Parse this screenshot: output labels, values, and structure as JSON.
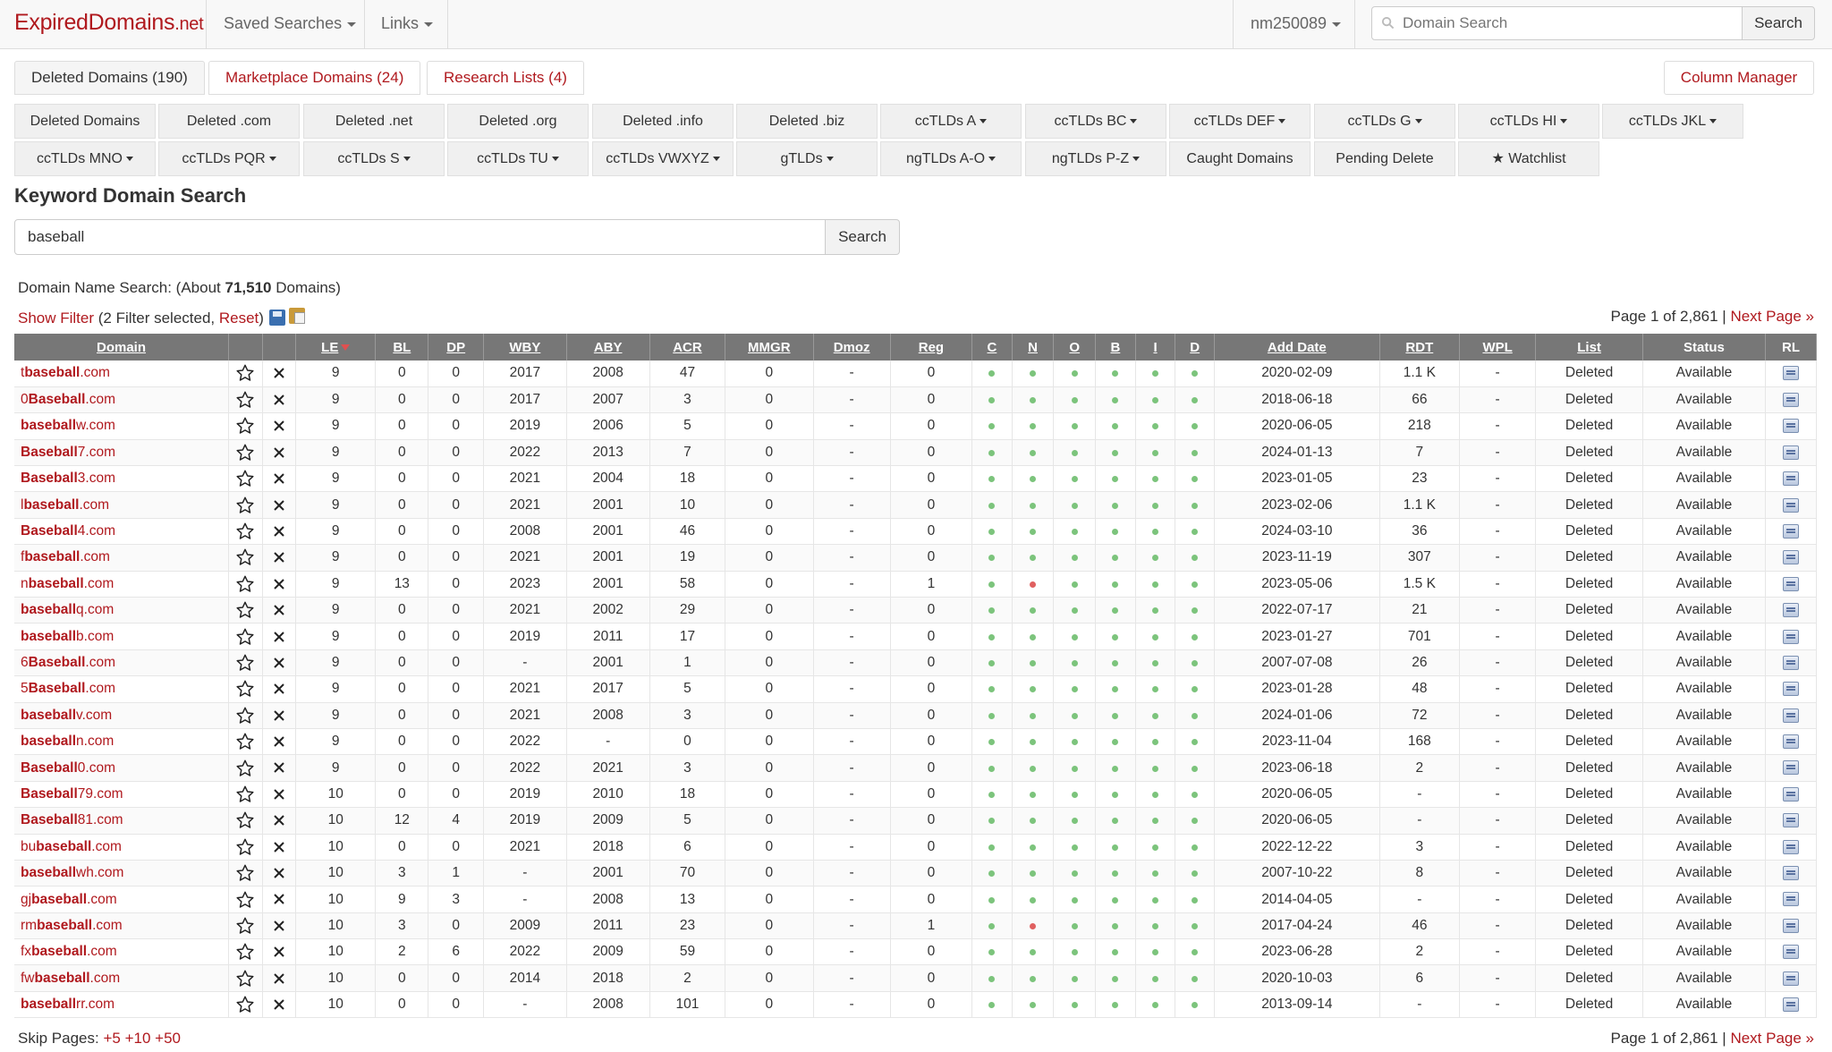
{
  "brand": {
    "name": "ExpiredDomains",
    "tld": ".net"
  },
  "nav": {
    "saved_searches": "Saved Searches",
    "links": "Links",
    "user": "nm250089",
    "search_placeholder": "Domain Search",
    "search_button": "Search"
  },
  "tabs": [
    {
      "label": "Deleted Domains (190)"
    },
    {
      "label": "Marketplace Domains (24)"
    },
    {
      "label": "Research Lists (4)"
    }
  ],
  "column_manager": "Column Manager",
  "categories_row1": [
    "Deleted Domains",
    "Deleted .com",
    "Deleted .net",
    "Deleted .org",
    "Deleted .info",
    "Deleted .biz",
    "ccTLDs A",
    "ccTLDs BC",
    "ccTLDs DEF",
    "ccTLDs G",
    "ccTLDs HI",
    "ccTLDs JKL"
  ],
  "categories_row2": [
    "ccTLDs MNO",
    "ccTLDs PQR",
    "ccTLDs S",
    "ccTLDs TU",
    "ccTLDs VWXYZ",
    "gTLDs",
    "ngTLDs A-O",
    "ngTLDs P-Z",
    "Caught Domains",
    "Pending Delete",
    "★ Watchlist"
  ],
  "keyword": {
    "title": "Keyword Domain Search",
    "value": "baseball",
    "button": "Search"
  },
  "info": {
    "prefix": "Domain Name Search: (About ",
    "count": "71,510",
    "suffix": " Domains)"
  },
  "filter": {
    "show": "Show Filter",
    "mid": " (2 Filter selected, ",
    "reset": "Reset",
    "end": ")"
  },
  "paging": {
    "text": "Page 1 of 2,861 | ",
    "next": "Next Page »"
  },
  "skip": {
    "label": "Skip Pages: ",
    "links": [
      "+5",
      "+10",
      "+50"
    ]
  },
  "columns": [
    "Domain",
    "",
    "",
    "LE",
    "BL",
    "DP",
    "WBY",
    "ABY",
    "ACR",
    "MMGR",
    "Dmoz",
    "Reg",
    "C",
    "N",
    "O",
    "B",
    "I",
    "D",
    "Add Date",
    "RDT",
    "WPL",
    "List",
    "Status",
    "RL"
  ],
  "rows": [
    {
      "pre": "t",
      "kw": "baseball",
      "post": ".com",
      "le": "9",
      "bl": "0",
      "dp": "0",
      "wby": "2017",
      "aby": "2008",
      "acr": "47",
      "mmgr": "0",
      "dmoz": "-",
      "reg": "0",
      "n_red": false,
      "date": "2020-02-09",
      "rdt": "1.1 K",
      "wpl": "-",
      "list": "Deleted",
      "status": "Available"
    },
    {
      "pre": "0",
      "kw": "Baseball",
      "post": ".com",
      "le": "9",
      "bl": "0",
      "dp": "0",
      "wby": "2017",
      "aby": "2007",
      "acr": "3",
      "mmgr": "0",
      "dmoz": "-",
      "reg": "0",
      "n_red": false,
      "date": "2018-06-18",
      "rdt": "66",
      "wpl": "-",
      "list": "Deleted",
      "status": "Available"
    },
    {
      "pre": "",
      "kw": "baseball",
      "post": "w.com",
      "le": "9",
      "bl": "0",
      "dp": "0",
      "wby": "2019",
      "aby": "2006",
      "acr": "5",
      "mmgr": "0",
      "dmoz": "-",
      "reg": "0",
      "n_red": false,
      "date": "2020-06-05",
      "rdt": "218",
      "wpl": "-",
      "list": "Deleted",
      "status": "Available"
    },
    {
      "pre": "",
      "kw": "Baseball",
      "post": "7.com",
      "le": "9",
      "bl": "0",
      "dp": "0",
      "wby": "2022",
      "aby": "2013",
      "acr": "7",
      "mmgr": "0",
      "dmoz": "-",
      "reg": "0",
      "n_red": false,
      "date": "2024-01-13",
      "rdt": "7",
      "wpl": "-",
      "list": "Deleted",
      "status": "Available"
    },
    {
      "pre": "",
      "kw": "Baseball",
      "post": "3.com",
      "le": "9",
      "bl": "0",
      "dp": "0",
      "wby": "2021",
      "aby": "2004",
      "acr": "18",
      "mmgr": "0",
      "dmoz": "-",
      "reg": "0",
      "n_red": false,
      "date": "2023-01-05",
      "rdt": "23",
      "wpl": "-",
      "list": "Deleted",
      "status": "Available"
    },
    {
      "pre": "l",
      "kw": "baseball",
      "post": ".com",
      "le": "9",
      "bl": "0",
      "dp": "0",
      "wby": "2021",
      "aby": "2001",
      "acr": "10",
      "mmgr": "0",
      "dmoz": "-",
      "reg": "0",
      "n_red": false,
      "date": "2023-02-06",
      "rdt": "1.1 K",
      "wpl": "-",
      "list": "Deleted",
      "status": "Available"
    },
    {
      "pre": "",
      "kw": "Baseball",
      "post": "4.com",
      "le": "9",
      "bl": "0",
      "dp": "0",
      "wby": "2008",
      "aby": "2001",
      "acr": "46",
      "mmgr": "0",
      "dmoz": "-",
      "reg": "0",
      "n_red": false,
      "date": "2024-03-10",
      "rdt": "36",
      "wpl": "-",
      "list": "Deleted",
      "status": "Available"
    },
    {
      "pre": "f",
      "kw": "baseball",
      "post": ".com",
      "le": "9",
      "bl": "0",
      "dp": "0",
      "wby": "2021",
      "aby": "2001",
      "acr": "19",
      "mmgr": "0",
      "dmoz": "-",
      "reg": "0",
      "n_red": false,
      "date": "2023-11-19",
      "rdt": "307",
      "wpl": "-",
      "list": "Deleted",
      "status": "Available"
    },
    {
      "pre": "n",
      "kw": "baseball",
      "post": ".com",
      "le": "9",
      "bl": "13",
      "dp": "0",
      "wby": "2023",
      "aby": "2001",
      "acr": "58",
      "mmgr": "0",
      "dmoz": "-",
      "reg": "1",
      "n_red": true,
      "date": "2023-05-06",
      "rdt": "1.5 K",
      "wpl": "-",
      "list": "Deleted",
      "status": "Available"
    },
    {
      "pre": "",
      "kw": "baseball",
      "post": "q.com",
      "le": "9",
      "bl": "0",
      "dp": "0",
      "wby": "2021",
      "aby": "2002",
      "acr": "29",
      "mmgr": "0",
      "dmoz": "-",
      "reg": "0",
      "n_red": false,
      "date": "2022-07-17",
      "rdt": "21",
      "wpl": "-",
      "list": "Deleted",
      "status": "Available"
    },
    {
      "pre": "",
      "kw": "baseball",
      "post": "b.com",
      "le": "9",
      "bl": "0",
      "dp": "0",
      "wby": "2019",
      "aby": "2011",
      "acr": "17",
      "mmgr": "0",
      "dmoz": "-",
      "reg": "0",
      "n_red": false,
      "date": "2023-01-27",
      "rdt": "701",
      "wpl": "-",
      "list": "Deleted",
      "status": "Available"
    },
    {
      "pre": "6",
      "kw": "Baseball",
      "post": ".com",
      "le": "9",
      "bl": "0",
      "dp": "0",
      "wby": "-",
      "aby": "2001",
      "acr": "1",
      "mmgr": "0",
      "dmoz": "-",
      "reg": "0",
      "n_red": false,
      "date": "2007-07-08",
      "rdt": "26",
      "wpl": "-",
      "list": "Deleted",
      "status": "Available"
    },
    {
      "pre": "5",
      "kw": "Baseball",
      "post": ".com",
      "le": "9",
      "bl": "0",
      "dp": "0",
      "wby": "2021",
      "aby": "2017",
      "acr": "5",
      "mmgr": "0",
      "dmoz": "-",
      "reg": "0",
      "n_red": false,
      "date": "2023-01-28",
      "rdt": "48",
      "wpl": "-",
      "list": "Deleted",
      "status": "Available"
    },
    {
      "pre": "",
      "kw": "baseball",
      "post": "v.com",
      "le": "9",
      "bl": "0",
      "dp": "0",
      "wby": "2021",
      "aby": "2008",
      "acr": "3",
      "mmgr": "0",
      "dmoz": "-",
      "reg": "0",
      "n_red": false,
      "date": "2024-01-06",
      "rdt": "72",
      "wpl": "-",
      "list": "Deleted",
      "status": "Available"
    },
    {
      "pre": "",
      "kw": "baseball",
      "post": "n.com",
      "le": "9",
      "bl": "0",
      "dp": "0",
      "wby": "2022",
      "aby": "-",
      "acr": "0",
      "mmgr": "0",
      "dmoz": "-",
      "reg": "0",
      "n_red": false,
      "date": "2023-11-04",
      "rdt": "168",
      "wpl": "-",
      "list": "Deleted",
      "status": "Available"
    },
    {
      "pre": "",
      "kw": "Baseball",
      "post": "0.com",
      "le": "9",
      "bl": "0",
      "dp": "0",
      "wby": "2022",
      "aby": "2021",
      "acr": "3",
      "mmgr": "0",
      "dmoz": "-",
      "reg": "0",
      "n_red": false,
      "date": "2023-06-18",
      "rdt": "2",
      "wpl": "-",
      "list": "Deleted",
      "status": "Available"
    },
    {
      "pre": "",
      "kw": "Baseball",
      "post": "79.com",
      "le": "10",
      "bl": "0",
      "dp": "0",
      "wby": "2019",
      "aby": "2010",
      "acr": "18",
      "mmgr": "0",
      "dmoz": "-",
      "reg": "0",
      "n_red": false,
      "date": "2020-06-05",
      "rdt": "-",
      "wpl": "-",
      "list": "Deleted",
      "status": "Available"
    },
    {
      "pre": "",
      "kw": "Baseball",
      "post": "81.com",
      "le": "10",
      "bl": "12",
      "dp": "4",
      "wby": "2019",
      "aby": "2009",
      "acr": "5",
      "mmgr": "0",
      "dmoz": "-",
      "reg": "0",
      "n_red": false,
      "date": "2020-06-05",
      "rdt": "-",
      "wpl": "-",
      "list": "Deleted",
      "status": "Available"
    },
    {
      "pre": "bu",
      "kw": "baseball",
      "post": ".com",
      "le": "10",
      "bl": "0",
      "dp": "0",
      "wby": "2021",
      "aby": "2018",
      "acr": "6",
      "mmgr": "0",
      "dmoz": "-",
      "reg": "0",
      "n_red": false,
      "date": "2022-12-22",
      "rdt": "3",
      "wpl": "-",
      "list": "Deleted",
      "status": "Available"
    },
    {
      "pre": "",
      "kw": "baseball",
      "post": "wh.com",
      "le": "10",
      "bl": "3",
      "dp": "1",
      "wby": "-",
      "aby": "2001",
      "acr": "70",
      "mmgr": "0",
      "dmoz": "-",
      "reg": "0",
      "n_red": false,
      "date": "2007-10-22",
      "rdt": "8",
      "wpl": "-",
      "list": "Deleted",
      "status": "Available"
    },
    {
      "pre": "gj",
      "kw": "baseball",
      "post": ".com",
      "le": "10",
      "bl": "9",
      "dp": "3",
      "wby": "-",
      "aby": "2008",
      "acr": "13",
      "mmgr": "0",
      "dmoz": "-",
      "reg": "0",
      "n_red": false,
      "date": "2014-04-05",
      "rdt": "-",
      "wpl": "-",
      "list": "Deleted",
      "status": "Available"
    },
    {
      "pre": "rm",
      "kw": "baseball",
      "post": ".com",
      "le": "10",
      "bl": "3",
      "dp": "0",
      "wby": "2009",
      "aby": "2011",
      "acr": "23",
      "mmgr": "0",
      "dmoz": "-",
      "reg": "1",
      "n_red": true,
      "date": "2017-04-24",
      "rdt": "46",
      "wpl": "-",
      "list": "Deleted",
      "status": "Available"
    },
    {
      "pre": "fx",
      "kw": "baseball",
      "post": ".com",
      "le": "10",
      "bl": "2",
      "dp": "6",
      "wby": "2022",
      "aby": "2009",
      "acr": "59",
      "mmgr": "0",
      "dmoz": "-",
      "reg": "0",
      "n_red": false,
      "date": "2023-06-28",
      "rdt": "2",
      "wpl": "-",
      "list": "Deleted",
      "status": "Available"
    },
    {
      "pre": "fw",
      "kw": "baseball",
      "post": ".com",
      "le": "10",
      "bl": "0",
      "dp": "0",
      "wby": "2014",
      "aby": "2018",
      "acr": "2",
      "mmgr": "0",
      "dmoz": "-",
      "reg": "0",
      "n_red": false,
      "date": "2020-10-03",
      "rdt": "6",
      "wpl": "-",
      "list": "Deleted",
      "status": "Available"
    },
    {
      "pre": "",
      "kw": "baseball",
      "post": "rr.com",
      "le": "10",
      "bl": "0",
      "dp": "0",
      "wby": "-",
      "aby": "2008",
      "acr": "101",
      "mmgr": "0",
      "dmoz": "-",
      "reg": "0",
      "n_red": false,
      "date": "2013-09-14",
      "rdt": "-",
      "wpl": "-",
      "list": "Deleted",
      "status": "Available"
    }
  ],
  "colors": {
    "accent": "#b0191e",
    "header_bg": "#777777",
    "available": "#2e9b2e",
    "dot_green": "#7cc47c",
    "dot_red": "#e06060"
  }
}
